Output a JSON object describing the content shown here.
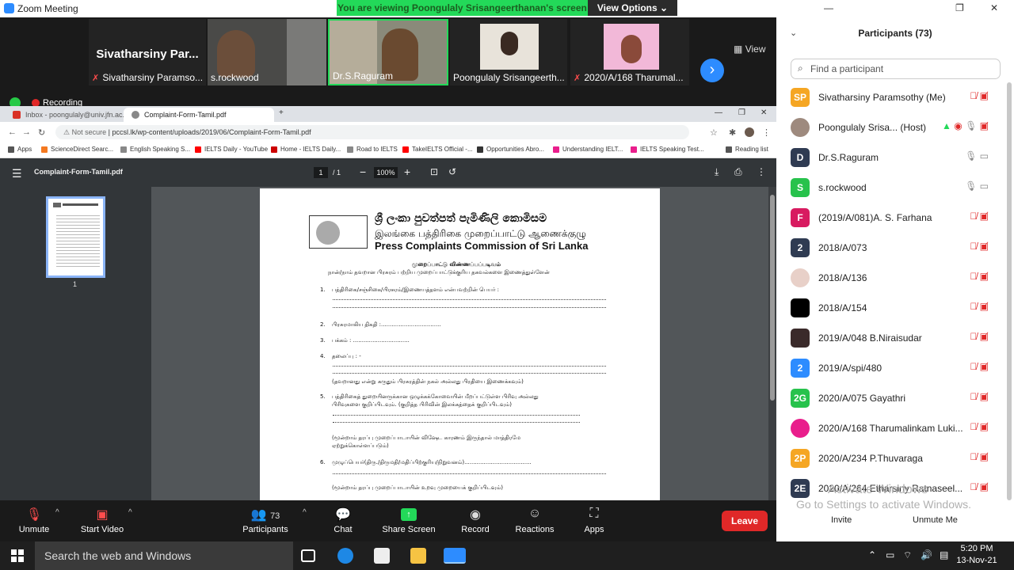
{
  "window": {
    "title": "Zoom Meeting"
  },
  "banner": {
    "text": "You are viewing Poongulaly Srisangeerthanan's screen",
    "view_options": "View Options"
  },
  "strip": {
    "tiles": [
      {
        "name": "Sivatharsiny Paramso...",
        "big": "Sivatharsiny  Par..."
      },
      {
        "name": "s.rockwood"
      },
      {
        "name": "Dr.S.Raguram"
      },
      {
        "name": "Poongulaly Srisangeerth..."
      },
      {
        "name": "2020/A/168 Tharumal..."
      }
    ],
    "view": "View"
  },
  "recording": "Recording",
  "browser": {
    "tabs": [
      {
        "title": "Inbox - poongulaly@univ.jfn.ac.lk"
      },
      {
        "title": "Complaint-Form-Tamil.pdf"
      }
    ],
    "url_prefix": "Not secure",
    "url": "pccsl.lk/wp-content/uploads/2019/06/Complaint-Form-Tamil.pdf",
    "bookmarks": [
      "Apps",
      "ScienceDirect Searc...",
      "English Speaking S...",
      "IELTS Daily - YouTube",
      "Home - IELTS Daily...",
      "Road to IELTS",
      "TakeIELTS Official -...",
      "Opportunities Abro...",
      "Understanding IELT...",
      "IELTS Speaking Test...",
      "Reading list"
    ]
  },
  "pdf": {
    "filename": "Complaint-Form-Tamil.pdf",
    "page": "1",
    "page_total": "/ 1",
    "zoom": "100%",
    "thumb_label": "1",
    "doc": {
      "heading_si": "ශ්‍රී ලංකා පුවත්පත් පැමිණිලි කොමිසම",
      "heading_ta": "இலங்கை பத்திரிகை முறைப்பாட்டு ஆணைக்குழு",
      "heading_en": "Press Complaints Commission of Sri Lanka",
      "form_title": "முறைப்பாட்டு விண்ணப்பப்படிவம்",
      "intro": "நான்/நாம் தவறான பிரசுரம் பற்றிய முறைப்பாட்டுக்குரிய தகவல்களை இணைத்துள்ளேன்",
      "items": [
        {
          "n": "1.",
          "t": "பத்திரிகை/சஞ்சிகை/பிரசுரம்/இணையத்தளம் என்பவற்றின் பெயர் :"
        },
        {
          "n": "2.",
          "t": "பிரசுரமாகிய திகதி  :.................................."
        },
        {
          "n": "3.",
          "t": "பக்கம்  :                  ................................"
        },
        {
          "n": "4.",
          "t": "தலைப்பு : -"
        },
        {
          "n": "",
          "t": "(தவறானது   என்று கருதும் பிரசுரத்தின் நகல் அல்லது பிரதியை இணைக்கவும்)"
        },
        {
          "n": "5.",
          "t": "பத்திரிகைத்  துறையினருக்கான  ஒழுக்கக்கோவையின்  மீறப்பட்டுள்ள  பிரிவு  அல்லது"
        },
        {
          "n": "",
          "t": "பிரிவுகளை குறிப்பிடவும். (குறித்த பிரிவின் இலக்கத்தைக் குறிப்பிடவும்)"
        },
        {
          "n": "",
          "t": "(மூன்றாம்  தரப்பு  முறைப்பாடாயின்  விஷேட  காரணம்  இருந்தால்  மாத்திரமே"
        },
        {
          "n": "",
          "t": "ஏற்றுக்கொள்ளப்படும்)"
        },
        {
          "n": "6.",
          "t": "முழுப்பெயர்(திரு./திருமதி/மதிப்பிற்குரிய/நிறுவனம்)......................................"
        },
        {
          "n": "",
          "t": "(மூன்றாம் தரப்பு முறைப்பாடாயின் உறவு முறையைக் குறிப்பிடவும்)"
        }
      ]
    }
  },
  "toolbar": {
    "unmute": "Unmute",
    "start_video": "Start Video",
    "participants": "Participants",
    "participants_count": "73",
    "chat": "Chat",
    "share": "Share Screen",
    "record": "Record",
    "reactions": "Reactions",
    "apps": "Apps",
    "leave": "Leave"
  },
  "panel": {
    "title": "Participants (73)",
    "search_placeholder": "Find a participant",
    "participants": [
      {
        "initials": "SP",
        "name": "Sivatharsiny Paramsothy (Me)",
        "color": "#f5a623"
      },
      {
        "initials": "",
        "name": "Poongulaly Srisa... (Host)",
        "color": "#9e8a7e"
      },
      {
        "initials": "D",
        "name": "Dr.S.Raguram",
        "color": "#2f3b52"
      },
      {
        "initials": "S",
        "name": "s.rockwood",
        "color": "#27c24c"
      },
      {
        "initials": "F",
        "name": "(2019/A/081)A. S. Farhana",
        "color": "#d81b60"
      },
      {
        "initials": "2",
        "name": "2018/A/073",
        "color": "#2f3b52"
      },
      {
        "initials": "",
        "name": "2018/A/136",
        "color": "#e8d0c8"
      },
      {
        "initials": "",
        "name": "2018/A/154",
        "color": "#000000"
      },
      {
        "initials": "",
        "name": "2019/A/048 B.Niraisudar",
        "color": "#3a2a2a"
      },
      {
        "initials": "2",
        "name": "2019/A/spi/480",
        "color": "#2d8cff"
      },
      {
        "initials": "2G",
        "name": "2020/A/075 Gayathri",
        "color": "#27c24c"
      },
      {
        "initials": "",
        "name": "2020/A/168 Tharumalinkam Luki...",
        "color": "#e91e8c"
      },
      {
        "initials": "2P",
        "name": "2020/A/234 P.Thuvaraga",
        "color": "#f5a623"
      },
      {
        "initials": "2E",
        "name": "2020/A/264 Etharsiny Ratnaseel...",
        "color": "#2f3b52"
      }
    ],
    "invite": "Invite",
    "unmute_me": "Unmute Me"
  },
  "activate": {
    "line1": "Activate Windows",
    "line2": "Go to Settings to activate Windows."
  },
  "taskbar": {
    "search": "Search the web and Windows",
    "time": "5:20 PM",
    "date": "13-Nov-21"
  }
}
